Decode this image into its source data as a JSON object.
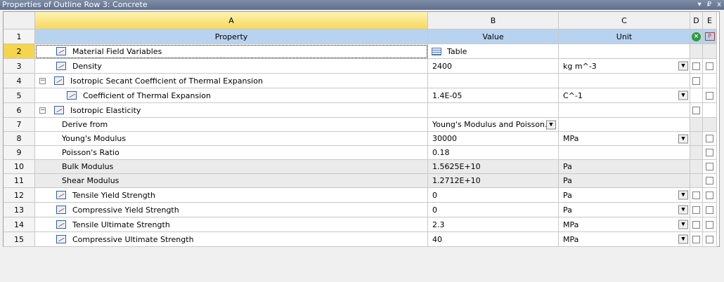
{
  "window": {
    "title": "Properties of Outline Row 3: Concrete",
    "controls": [
      "▾",
      "₽",
      "x"
    ]
  },
  "columns": {
    "a": "A",
    "b": "B",
    "c": "C",
    "d": "D",
    "e": "E"
  },
  "header": {
    "num": "1",
    "property": "Property",
    "value": "Value",
    "unit": "Unit"
  },
  "icons": {
    "d_header": "filter-x-icon",
    "e_header": "parameter-icon",
    "property": "chart-icon",
    "table": "table-icon"
  },
  "rows": [
    {
      "num": "2",
      "property": "Material Field Variables",
      "value": "Table",
      "unit": ""
    },
    {
      "num": "3",
      "property": "Density",
      "value": "2400",
      "unit": "kg m^-3"
    },
    {
      "num": "4",
      "property": "Isotropic Secant Coefficient of Thermal Expansion",
      "value": "",
      "unit": ""
    },
    {
      "num": "5",
      "property": "Coefficient of Thermal Expansion",
      "value": "1.4E-05",
      "unit": "C^-1"
    },
    {
      "num": "6",
      "property": "Isotropic Elasticity",
      "value": "",
      "unit": ""
    },
    {
      "num": "7",
      "property": "Derive from",
      "value": "Young's Modulus and Poisson...",
      "unit": ""
    },
    {
      "num": "8",
      "property": "Young's Modulus",
      "value": "30000",
      "unit": "MPa"
    },
    {
      "num": "9",
      "property": "Poisson's Ratio",
      "value": "0.18",
      "unit": ""
    },
    {
      "num": "10",
      "property": "Bulk Modulus",
      "value": "1.5625E+10",
      "unit": "Pa"
    },
    {
      "num": "11",
      "property": "Shear Modulus",
      "value": "1.2712E+10",
      "unit": "Pa"
    },
    {
      "num": "12",
      "property": "Tensile Yield Strength",
      "value": "0",
      "unit": "Pa"
    },
    {
      "num": "13",
      "property": "Compressive Yield Strength",
      "value": "0",
      "unit": "Pa"
    },
    {
      "num": "14",
      "property": "Tensile Ultimate Strength",
      "value": "2.3",
      "unit": "MPa"
    },
    {
      "num": "15",
      "property": "Compressive Ultimate Strength",
      "value": "40",
      "unit": "MPa"
    }
  ]
}
